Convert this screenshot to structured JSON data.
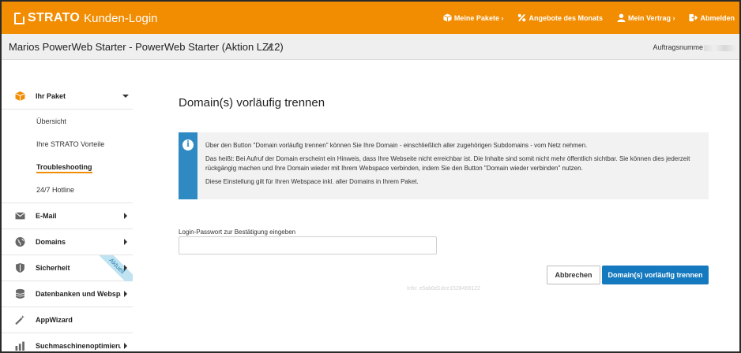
{
  "header": {
    "brand": "STRATO",
    "title": "Kunden-Login",
    "nav": [
      {
        "label": "Meine Pakete ›",
        "icon": "box-icon"
      },
      {
        "label": "Angebote des Monats",
        "icon": "percent-icon"
      },
      {
        "label": "Mein Vertrag ›",
        "icon": "user-icon"
      },
      {
        "label": "Abmelden",
        "icon": "logout-icon"
      }
    ],
    "accent_color": "#f28c00"
  },
  "subheader": {
    "package_title": "Marios PowerWeb Starter - PowerWeb Starter (Aktion LZ12)",
    "order_label": "Auftragsnumme"
  },
  "sidebar": {
    "ihr_paket": {
      "label": "Ihr Paket",
      "icon": "package-icon"
    },
    "subitems": [
      "Übersicht",
      "Ihre STRATO Vorteile",
      "Troubleshooting",
      "24/7 Hotline"
    ],
    "active_subitem": "Troubleshooting",
    "items": [
      {
        "label": "E-Mail",
        "icon": "mail-icon"
      },
      {
        "label": "Domains",
        "icon": "globe-icon"
      },
      {
        "label": "Sicherheit",
        "icon": "shield-icon",
        "ribbon": "Aktuell"
      },
      {
        "label": "Datenbanken und Webspace",
        "icon": "database-icon"
      },
      {
        "label": "AppWizard",
        "icon": "wand-icon"
      },
      {
        "label": "Suchmaschinenoptimierung",
        "icon": "search-optimize-icon"
      }
    ]
  },
  "main": {
    "title": "Domain(s) vorläufig trennen",
    "info": {
      "p1": "Über den Button \"Domain vorläufig trennen\" können Sie Ihre Domain - einschließlich aller zugehörigen Subdomains - vom Netz nehmen.",
      "p2": "Das heißt: Bei Aufruf der Domain erscheint ein Hinweis, dass Ihre Webseite nicht erreichbar ist. Die Inhalte sind somit nicht mehr öffentlich sichtbar. Sie können dies jederzeit rückgängig machen und Ihre Domain wieder mit Ihrem Webspace verbinden, indem Sie den Button \"Domain wieder verbinden\" nutzen.",
      "p3": "Diese Einstellung gilt für Ihren Webspace inkl. aller Domains in Ihrem Paket."
    },
    "password_label": "Login-Passwort zur Bestätigung eingeben",
    "password_value": "",
    "cancel_label": "Abbrechen",
    "submit_label": "Domain(s) vorläufig trennen",
    "info_id": "Info: e5ab0d1dce1528469122",
    "primary_color": "#1479be"
  }
}
